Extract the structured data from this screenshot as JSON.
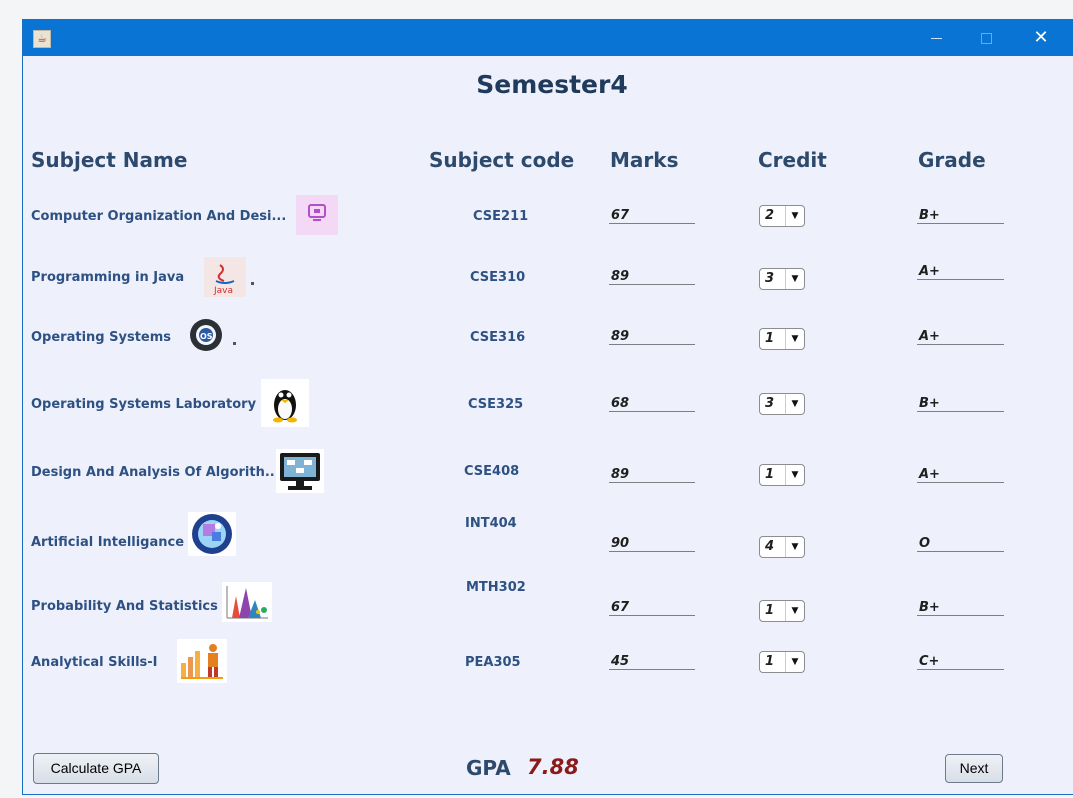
{
  "window": {
    "title_icon": "java-cup-icon",
    "controls": [
      "minimize-icon",
      "maximize-icon",
      "close-icon"
    ]
  },
  "page_title": "Semester4",
  "headers": {
    "subject_name": "Subject Name",
    "subject_code": "Subject code",
    "marks": "Marks",
    "credit": "Credit",
    "grade": "Grade"
  },
  "rows": [
    {
      "name": "Computer Organization And Desi...",
      "icon": "computer-chip-icon",
      "code": "CSE211",
      "marks": "67",
      "credit": "2",
      "grade": "B+"
    },
    {
      "name": "Programming in Java",
      "icon": "java-logo-icon",
      "code": "CSE310",
      "marks": "89",
      "credit": "3",
      "grade": "A+"
    },
    {
      "name": "Operating Systems",
      "icon": "os-gear-icon",
      "code": "CSE316",
      "marks": "89",
      "credit": "1",
      "grade": "A+"
    },
    {
      "name": "Operating Systems Laboratory",
      "icon": "linux-penguin-icon",
      "code": "CSE325",
      "marks": "68",
      "credit": "3",
      "grade": "B+"
    },
    {
      "name": "Design And Analysis Of Algorith...",
      "icon": "algorithm-monitor-icon",
      "code": "CSE408",
      "marks": "89",
      "credit": "1",
      "grade": "A+"
    },
    {
      "name": "Artificial Intelligance",
      "icon": "ai-brain-icon",
      "code": "INT404",
      "marks": "90",
      "credit": "4",
      "grade": "O"
    },
    {
      "name": "Probability And Statistics",
      "icon": "statistics-chart-icon",
      "code": "MTH302",
      "marks": "67",
      "credit": "1",
      "grade": "B+"
    },
    {
      "name": "Analytical Skills-I",
      "icon": "analytics-person-icon",
      "code": "PEA305",
      "marks": "45",
      "credit": "1",
      "grade": "C+"
    }
  ],
  "footer": {
    "calculate_button": "Calculate GPA",
    "gpa_label": "GPA",
    "gpa_value": "7.88",
    "next_button": "Next"
  },
  "colors": {
    "titlebar": "#0a74d4",
    "window_bg": "#eef1fb",
    "header_text": "#2d4a6c",
    "subject_text": "#2e5184",
    "gpa_value": "#8b1a1a"
  }
}
